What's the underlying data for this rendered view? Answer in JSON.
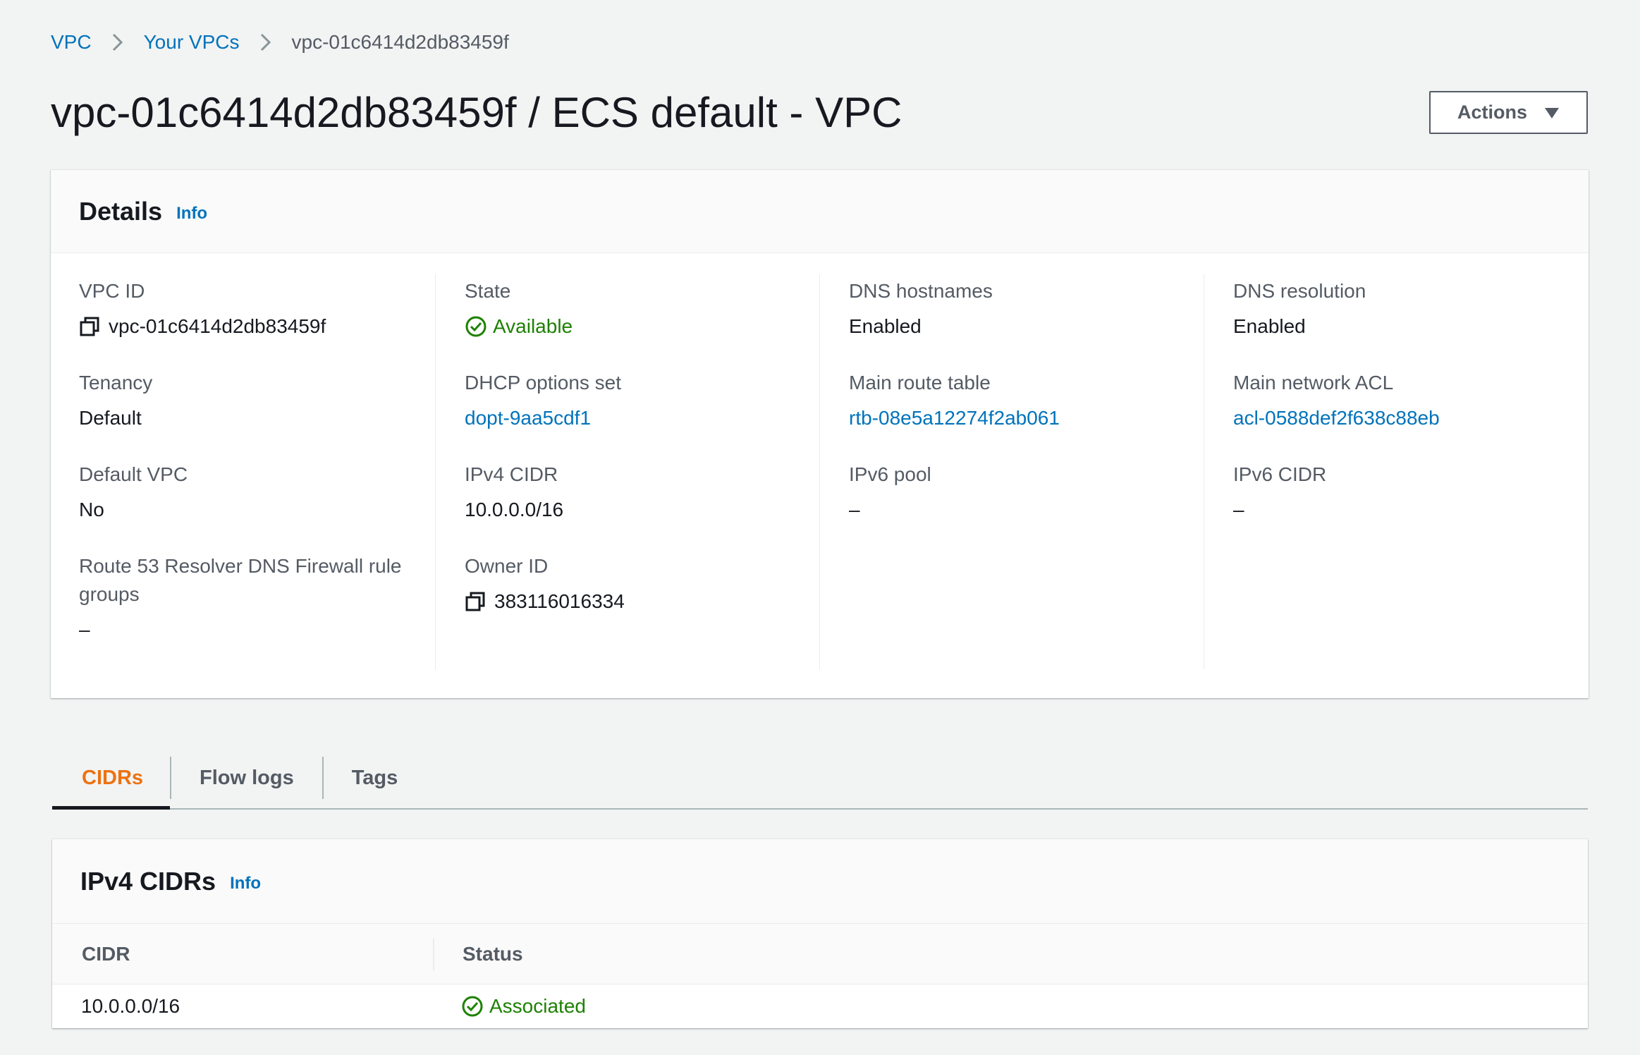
{
  "breadcrumb": {
    "items": [
      {
        "label": "VPC"
      },
      {
        "label": "Your VPCs"
      },
      {
        "label": "vpc-01c6414d2db83459f"
      }
    ]
  },
  "page": {
    "title": "vpc-01c6414d2db83459f / ECS default - VPC",
    "actions_label": "Actions"
  },
  "details": {
    "title": "Details",
    "info_label": "Info",
    "fields": {
      "vpc_id": {
        "label": "VPC ID",
        "value": "vpc-01c6414d2db83459f"
      },
      "state": {
        "label": "State",
        "value": "Available"
      },
      "dns_hostnames": {
        "label": "DNS hostnames",
        "value": "Enabled"
      },
      "dns_resolution": {
        "label": "DNS resolution",
        "value": "Enabled"
      },
      "tenancy": {
        "label": "Tenancy",
        "value": "Default"
      },
      "dhcp_options": {
        "label": "DHCP options set",
        "value": "dopt-9aa5cdf1"
      },
      "main_route_table": {
        "label": "Main route table",
        "value": "rtb-08e5a12274f2ab061"
      },
      "main_network_acl": {
        "label": "Main network ACL",
        "value": "acl-0588def2f638c88eb"
      },
      "default_vpc": {
        "label": "Default VPC",
        "value": "No"
      },
      "ipv4_cidr": {
        "label": "IPv4 CIDR",
        "value": "10.0.0.0/16"
      },
      "ipv6_pool": {
        "label": "IPv6 pool",
        "value": "–"
      },
      "ipv6_cidr": {
        "label": "IPv6 CIDR",
        "value": "–"
      },
      "route53": {
        "label": "Route 53 Resolver DNS Firewall rule groups",
        "value": "–"
      },
      "owner_id": {
        "label": "Owner ID",
        "value": "383116016334"
      }
    }
  },
  "tabs": [
    {
      "label": "CIDRs",
      "active": true
    },
    {
      "label": "Flow logs",
      "active": false
    },
    {
      "label": "Tags",
      "active": false
    }
  ],
  "ipv4_cidrs": {
    "title": "IPv4 CIDRs",
    "info_label": "Info",
    "columns": [
      "CIDR",
      "Status"
    ],
    "rows": [
      {
        "cidr": "10.0.0.0/16",
        "status": "Associated"
      }
    ]
  },
  "colors": {
    "link": "#0073bb",
    "success": "#1d8102",
    "active_tab": "#ec7211",
    "background": "#f2f3f3"
  },
  "icons": {
    "copy": "copy-icon",
    "status_ok": "check-circle-icon",
    "caret": "caret-down-icon",
    "breadcrumb_separator": "chevron-right-icon"
  }
}
